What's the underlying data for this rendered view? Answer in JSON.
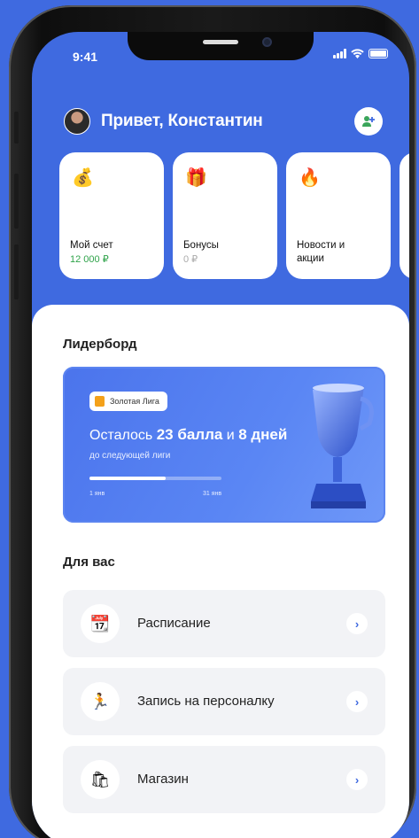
{
  "status_bar": {
    "time": "9:41"
  },
  "header": {
    "greeting": "Привет, Константин"
  },
  "quick_cards": [
    {
      "icon": "money-bag-icon",
      "glyph": "💰",
      "title": "Мой счет",
      "value": "12 000 ₽",
      "value_color": "#2fa34a"
    },
    {
      "icon": "gift-icon",
      "glyph": "🎁",
      "title": "Бонусы",
      "value": "0 ₽"
    },
    {
      "icon": "fire-icon",
      "glyph": "🔥",
      "title": "Новости и",
      "title2": "акции"
    }
  ],
  "leaderboard": {
    "title": "Лидерборд",
    "league": "Золотая Лига",
    "text_prefix": "Осталось",
    "points": "23 балла",
    "and": "и",
    "days": "8 дней",
    "subtitle": "до следующей лиги",
    "progress": 0.58,
    "start_label": "1 янв",
    "end_label": "31 янв"
  },
  "for_you": {
    "title": "Для вас",
    "items": [
      {
        "icon": "calendar-icon",
        "glyph": "📆",
        "label": "Расписание"
      },
      {
        "icon": "runner-icon",
        "glyph": "🏃",
        "label": "Запись на персоналку"
      },
      {
        "icon": "shopping-bag-icon",
        "glyph": "🛍",
        "label": "Магазин"
      }
    ]
  },
  "colors": {
    "accent": "#3f6ae0",
    "success": "#2fa34a"
  }
}
